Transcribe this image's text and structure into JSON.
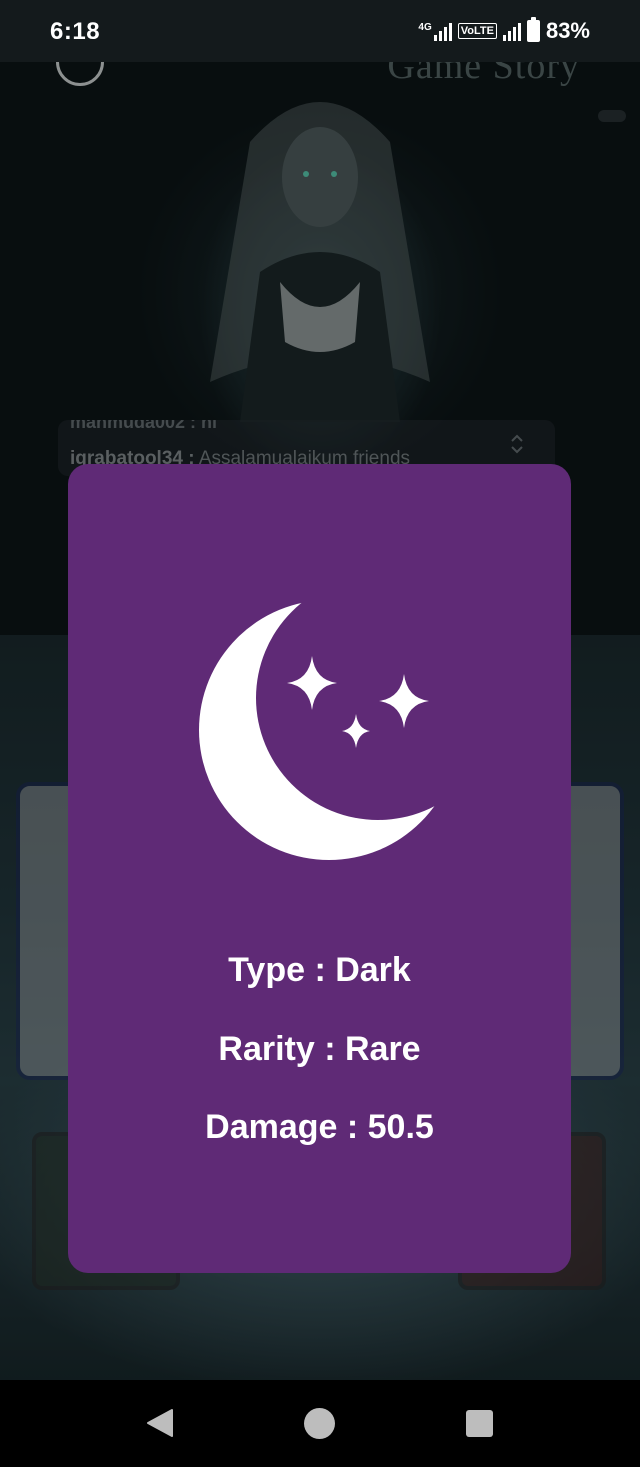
{
  "status_bar": {
    "time": "6:18",
    "network_label": "4G",
    "volte_label": "VoLTE",
    "battery_percent": "83%"
  },
  "background_app": {
    "title": "Game Story",
    "chat": {
      "clipped_line": "mahmuda002 :  hi",
      "username": "iqrabatool34 :",
      "message": "Assalamualaikum friends"
    }
  },
  "modal": {
    "icon": "moon-stars-icon",
    "background_color": "#5f2a76",
    "type_label": "Type : Dark",
    "rarity_label": "Rarity : Rare",
    "damage_label": "Damage : 50.5"
  },
  "nav_bar": {
    "back_icon": "back-triangle-icon",
    "home_icon": "home-circle-icon",
    "recent_icon": "recent-square-icon"
  }
}
